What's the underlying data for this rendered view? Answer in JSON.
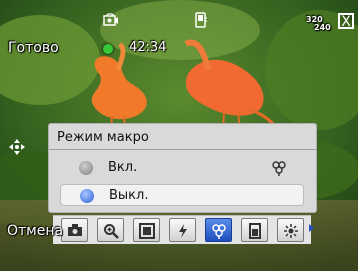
{
  "status": {
    "ready_label": "Готово",
    "timer": "42:34",
    "resolution_top": "320",
    "resolution_bottom": "240",
    "close_label": "X"
  },
  "macro_panel": {
    "title": "Режим макро",
    "options": [
      {
        "label": "Вкл.",
        "selected": false
      },
      {
        "label": "Выкл.",
        "selected": true
      }
    ]
  },
  "toolbar": {
    "buttons": [
      {
        "icon": "camera-settings-icon",
        "active": false
      },
      {
        "icon": "zoom-icon",
        "active": false
      },
      {
        "icon": "frame-icon",
        "active": false
      },
      {
        "icon": "flash-icon",
        "active": false
      },
      {
        "icon": "macro-icon",
        "active": true
      },
      {
        "icon": "storage-icon",
        "active": false
      },
      {
        "icon": "white-balance-icon",
        "active": false
      }
    ]
  },
  "softkeys": {
    "left": "Отмена"
  },
  "colors": {
    "accent": "#2c5fd6",
    "panel_bg": "#d9d9d9"
  }
}
